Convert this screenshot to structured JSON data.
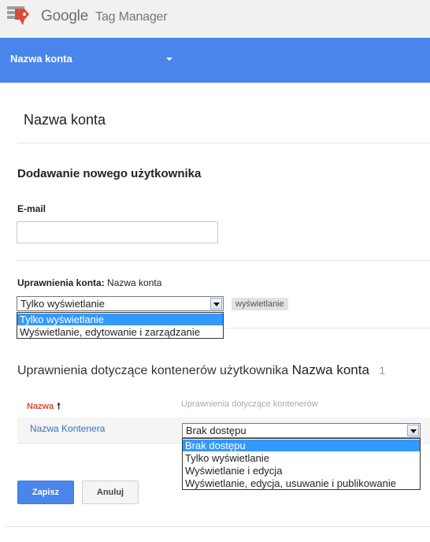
{
  "header": {
    "brand_google": "Google",
    "brand_product": "Tag Manager",
    "account_selector": "Nazwa konta"
  },
  "page": {
    "title": "Nazwa konta"
  },
  "new_user": {
    "section_title": "Dodawanie nowego użytkownika",
    "email_label": "E-mail",
    "email_value": "",
    "account_permissions_label": "Uprawnienia konta:",
    "account_permissions_account": "Nazwa konta",
    "account_permission_selected": "Tylko wyświetlanie",
    "account_permission_options": [
      "Tylko wyświetlanie",
      "Wyświetlanie, edytowanie i zarządzanie"
    ],
    "permission_badge": "wyświetlanie"
  },
  "containers": {
    "title_prefix": "Uprawnienia dotyczące kontenerów użytkownika",
    "title_account": "Nazwa konta",
    "count": "1",
    "col_name": "Nazwa",
    "col_permissions": "Uprawnienia dotyczące kontenerów",
    "rows": [
      {
        "name": "Nazwa Kontenera",
        "permission_selected": "Brak dostępu",
        "permission_options": [
          "Brak dostępu",
          "Tylko wyświetlanie",
          "Wyświetlanie i edycja",
          "Wyświetlanie, edycja, usuwanie i publikowanie"
        ]
      }
    ]
  },
  "actions": {
    "save_label": "Zapisz",
    "cancel_label": "Anuluj"
  },
  "colors": {
    "accent_blue": "#4a85ec",
    "selection": "#3399ff",
    "sort_column": "#dd4b39"
  }
}
